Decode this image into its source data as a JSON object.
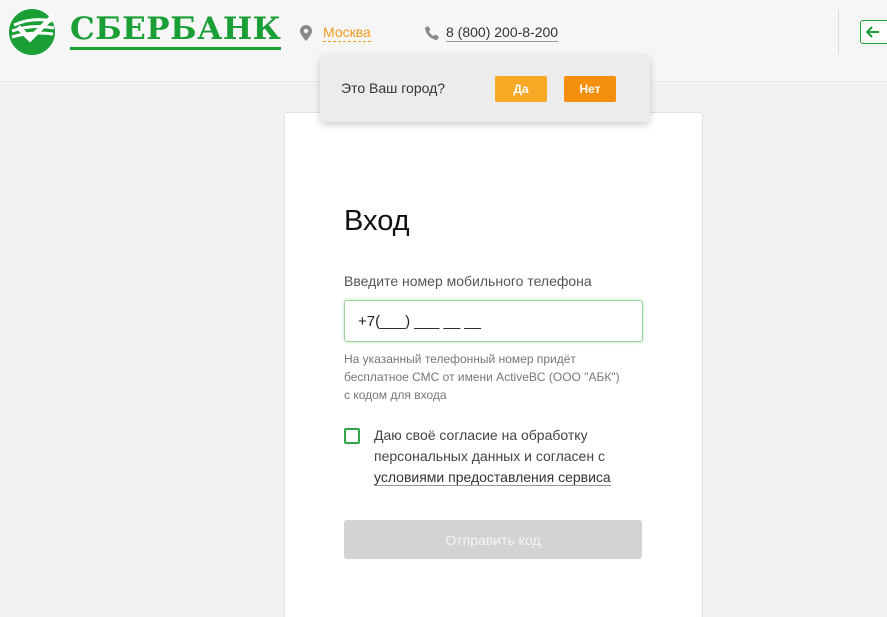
{
  "header": {
    "logo_text": "СБЕРБАНК",
    "city": "Москва",
    "phone": "8 (800) 200-8-200"
  },
  "city_popup": {
    "question": "Это Ваш город?",
    "yes_label": "Да",
    "no_label": "Нет"
  },
  "login": {
    "title": "Вход",
    "phone_label": "Введите номер мобильного телефона",
    "phone_value": "+7(___) ___ __ __",
    "hint": "На указанный телефонный номер придёт бесплатное СМС от имени ActiveBC (ООО \"АБК\") с кодом для входа",
    "consent_text": "Даю своё согласие на обработку персональных данных и согласен с",
    "consent_link": "условиями предоставления сервиса",
    "consent_checked": false,
    "submit_label": "Отправить код"
  },
  "colors": {
    "brand_green": "#1a9e36",
    "accent_orange": "#f29b1c",
    "yes_button": "#f9a825",
    "no_button": "#f5900e",
    "disabled_button": "#d3d3d3"
  },
  "icons": [
    "sberbank-logo-icon",
    "map-pin-icon",
    "phone-icon",
    "exit-arrow-icon"
  ]
}
